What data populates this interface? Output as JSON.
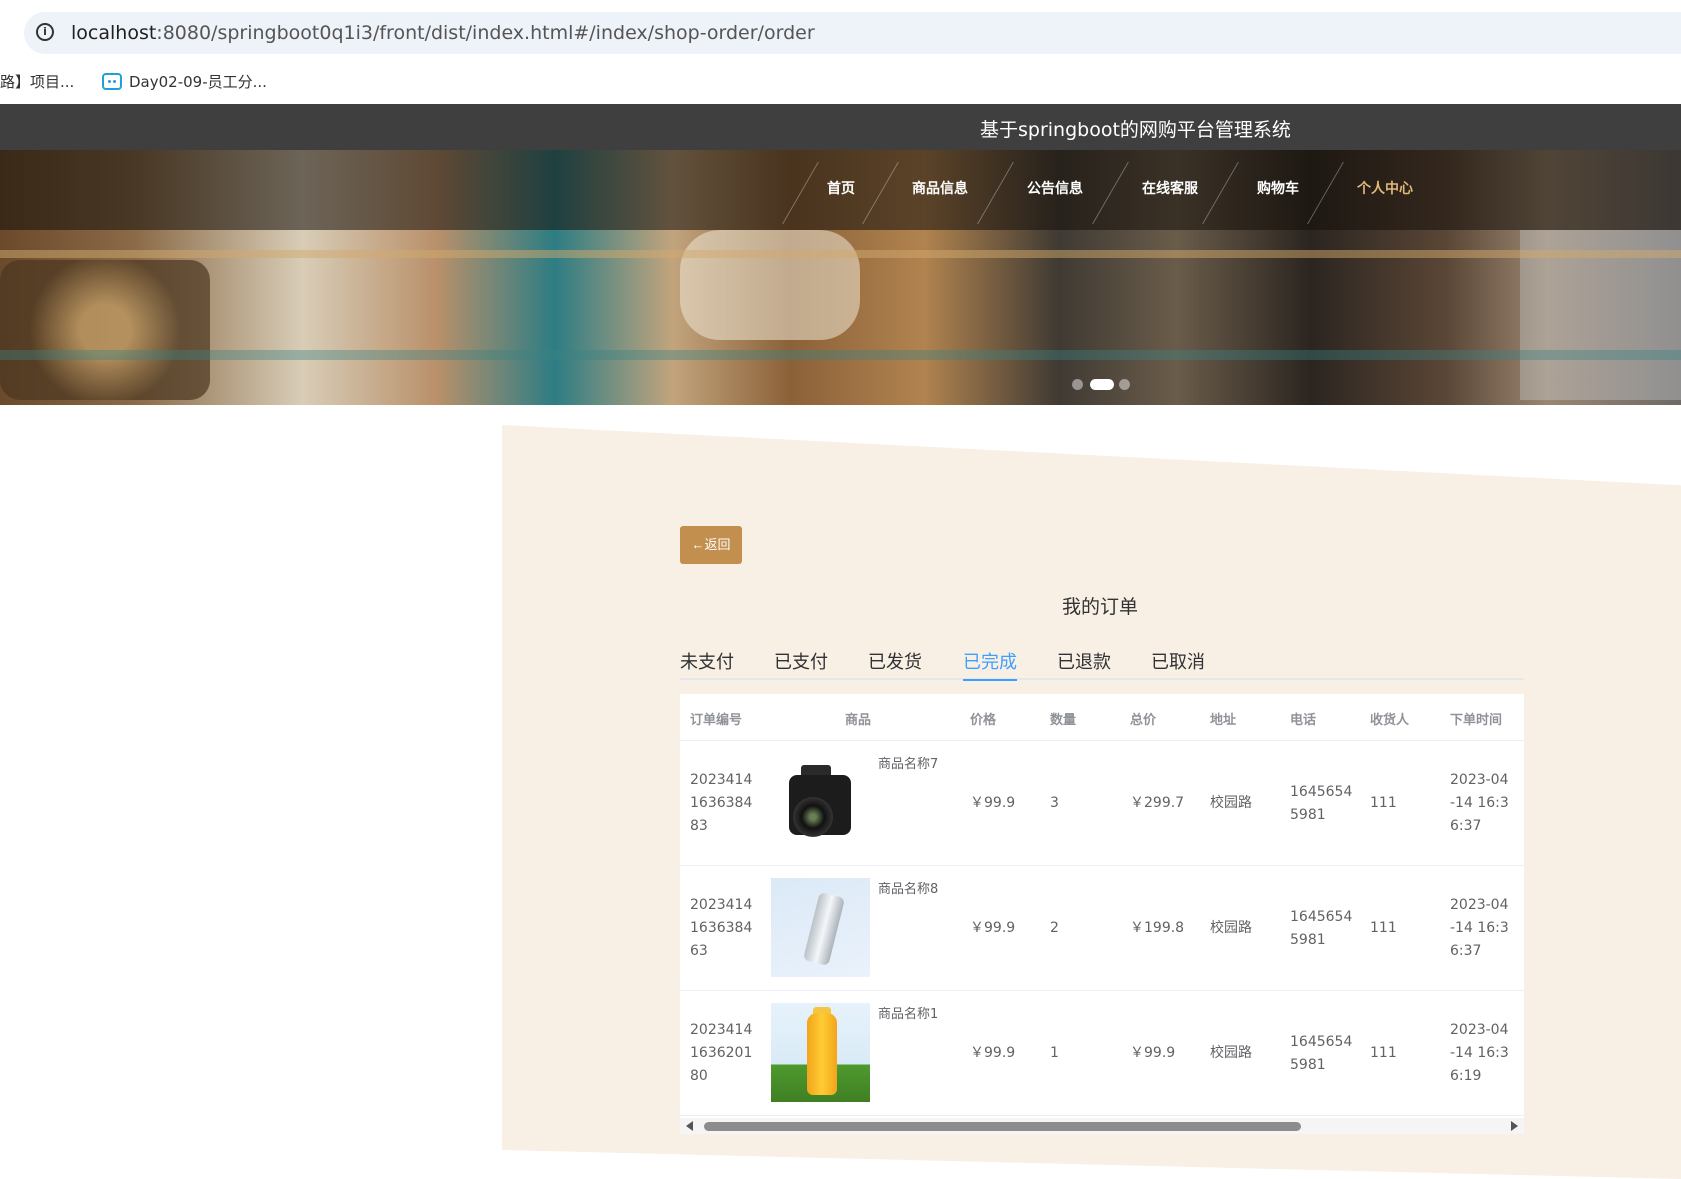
{
  "browser": {
    "url_host": "localhost",
    "url_rest": ":8080/springboot0q1i3/front/dist/index.html#/index/shop-order/order",
    "bookmarks": [
      {
        "label": "路】项目..."
      },
      {
        "label": "Day02-09-员工分..."
      }
    ]
  },
  "site": {
    "title": "基于springboot的网购平台管理系统",
    "nav": [
      {
        "label": "首页",
        "active": false
      },
      {
        "label": "商品信息",
        "active": false
      },
      {
        "label": "公告信息",
        "active": false
      },
      {
        "label": "在线客服",
        "active": false
      },
      {
        "label": "购物车",
        "active": false
      },
      {
        "label": "个人中心",
        "active": true
      }
    ],
    "carousel": {
      "count": 3,
      "active_index": 1
    }
  },
  "main": {
    "back_label": "←返回",
    "page_title": "我的订单",
    "tabs": [
      {
        "label": "未支付",
        "active": false
      },
      {
        "label": "已支付",
        "active": false
      },
      {
        "label": "已发货",
        "active": false
      },
      {
        "label": "已完成",
        "active": true
      },
      {
        "label": "已退款",
        "active": false
      },
      {
        "label": "已取消",
        "active": false
      }
    ],
    "table": {
      "headers": [
        "订单编号",
        "商品",
        "价格",
        "数量",
        "总价",
        "地址",
        "电话",
        "收货人",
        "下单时间"
      ],
      "rows": [
        {
          "order_no": "202341416363 8483",
          "order_no_lines": [
            "2023414",
            "1636384",
            "83"
          ],
          "product": "商品名称7",
          "image": "camera-image",
          "price": "￥99.9",
          "qty": "3",
          "total": "￥299.7",
          "address": "校园路",
          "phone_lines": [
            "1645654",
            "5981"
          ],
          "receiver": "111",
          "time_lines": [
            "2023-04",
            "-14 16:3",
            "6:37"
          ]
        },
        {
          "order_no": "",
          "order_no_lines": [
            "2023414",
            "1636384",
            "63"
          ],
          "product": "商品名称8",
          "image": "bottle-image",
          "price": "￥99.9",
          "qty": "2",
          "total": "￥199.8",
          "address": "校园路",
          "phone_lines": [
            "1645654",
            "5981"
          ],
          "receiver": "111",
          "time_lines": [
            "2023-04",
            "-14 16:3",
            "6:37"
          ]
        },
        {
          "order_no": "",
          "order_no_lines": [
            "2023414",
            "1636201",
            "80"
          ],
          "product": "商品名称1",
          "image": "juice-image",
          "price": "￥99.9",
          "qty": "1",
          "total": "￥99.9",
          "address": "校园路",
          "phone_lines": [
            "1645654",
            "5981"
          ],
          "receiver": "111",
          "time_lines": [
            "2023-04",
            "-14 16:3",
            "6:19"
          ]
        }
      ]
    },
    "scroll": {
      "fraction_visible": 0.75,
      "position": 0
    }
  },
  "colors": {
    "accent": "#c28f4f",
    "active_tab": "#409eff",
    "header_bg": "#3f3f3f",
    "panel_bg": "#f8efe5",
    "nav_active": "#e0b878"
  }
}
